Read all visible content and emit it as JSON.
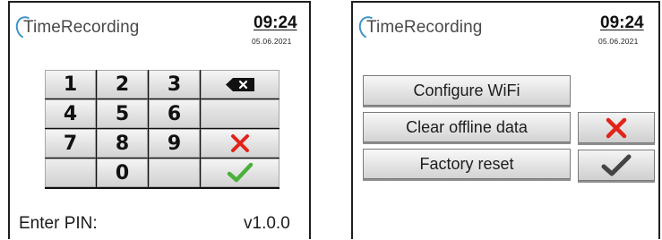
{
  "left_screen": {
    "app_name": "TimeRecording",
    "time": "09:24",
    "date": "05.06.2021",
    "keypad": {
      "keys": [
        "1",
        "2",
        "3",
        "4",
        "5",
        "6",
        "7",
        "8",
        "9",
        "0"
      ],
      "backspace_icon": "backspace-icon",
      "cancel_icon": "red-x-icon",
      "confirm_icon": "green-check-icon"
    },
    "prompt": "Enter PIN:",
    "version": "v1.0.0"
  },
  "right_screen": {
    "app_name": "TimeRecording",
    "time": "09:24",
    "date": "05.06.2021",
    "menu": {
      "configure_wifi": "Configure WiFi",
      "clear_offline": "Clear offline data",
      "factory_reset": "Factory reset"
    },
    "cancel_icon": "red-x-icon",
    "confirm_icon": "dark-check-icon"
  },
  "colors": {
    "accent": "#3e93c9",
    "cancel_red": "#e2231a",
    "confirm_green": "#4caf3c",
    "confirm_dark": "#444444",
    "border": "#1f1f1f"
  }
}
